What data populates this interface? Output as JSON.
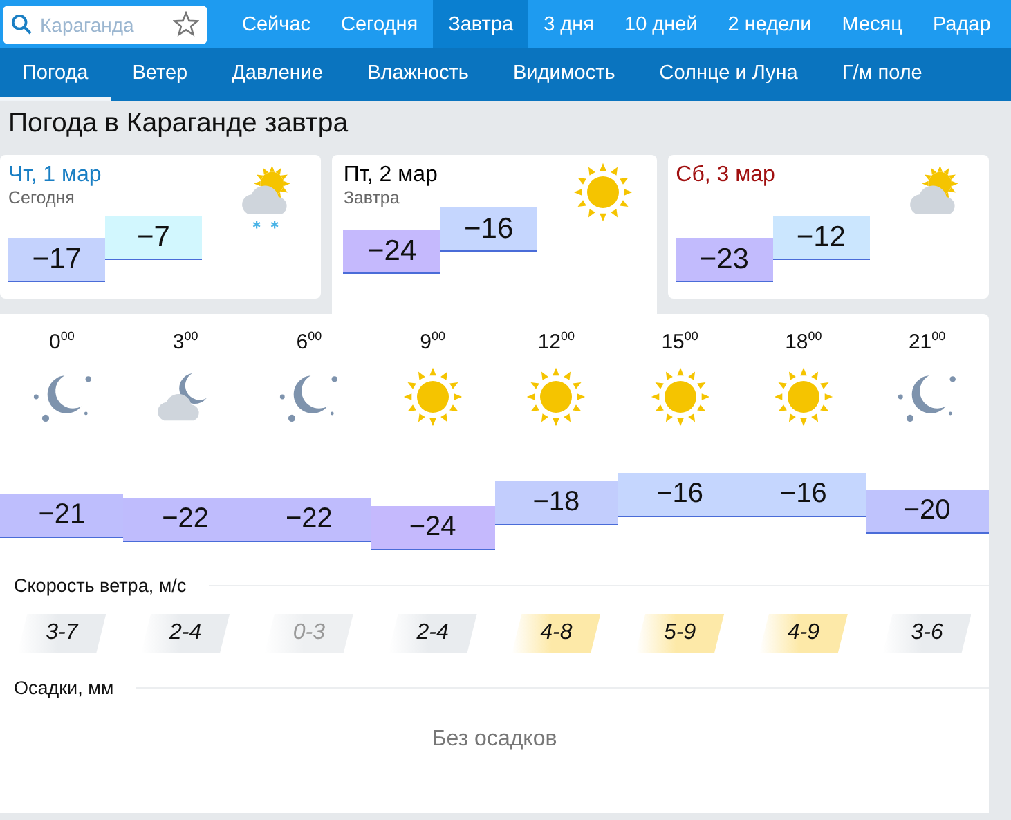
{
  "search": {
    "placeholder": "Караганда"
  },
  "nav_tabs": [
    {
      "label": "Сейчас",
      "selected": false
    },
    {
      "label": "Сегодня",
      "selected": false
    },
    {
      "label": "Завтра",
      "selected": true
    },
    {
      "label": "3 дня",
      "selected": false
    },
    {
      "label": "10 дней",
      "selected": false
    },
    {
      "label": "2 недели",
      "selected": false
    },
    {
      "label": "Месяц",
      "selected": false
    },
    {
      "label": "Радар",
      "selected": false
    }
  ],
  "sub_tabs": [
    {
      "label": "Погода",
      "selected": true
    },
    {
      "label": "Ветер",
      "selected": false
    },
    {
      "label": "Давление",
      "selected": false
    },
    {
      "label": "Влажность",
      "selected": false
    },
    {
      "label": "Видимость",
      "selected": false
    },
    {
      "label": "Солнце и Луна",
      "selected": false
    },
    {
      "label": "Г/м поле",
      "selected": false
    }
  ],
  "title": "Погода в Караганде завтра",
  "days": [
    {
      "name": "Чт, 1 мар",
      "color": "#1a7fc4",
      "note": "Сегодня",
      "kind": "snow",
      "min": "−17",
      "max": "−7",
      "selected": false
    },
    {
      "name": "Пт, 2 мар",
      "color": "#000000",
      "note": "Завтра",
      "kind": "sunny",
      "min": "−24",
      "max": "−16",
      "selected": true
    },
    {
      "name": "Сб, 3 мар",
      "color": "#a01010",
      "kind": "cloudy",
      "min": "−23",
      "max": "−12",
      "selected": false
    }
  ],
  "hours": [
    {
      "time": "0$^{00}$",
      "kind": "night",
      "temp": "−21"
    },
    {
      "time": "3$^{00}$",
      "kind": "cloudy",
      "temp": "−22"
    },
    {
      "time": "6$^{00}$",
      "kind": "night",
      "temp": "−22"
    },
    {
      "time": "9$^{00}$",
      "kind": "sunny",
      "temp": "−24"
    },
    {
      "time": "12$^{00}$",
      "kind": "sunny",
      "temp": "−18"
    },
    {
      "time": "15$^{00}$",
      "kind": "sunny",
      "temp": "−16"
    },
    {
      "time": "18$^{00}$",
      "kind": "sunny",
      "temp": "−16"
    },
    {
      "time": "21$^{00}$",
      "kind": "night",
      "temp": "−20"
    }
  ],
  "wind_label": "Скорость ветра, м/с",
  "winds": [
    {
      "text": "3-7",
      "kind": "normal"
    },
    {
      "text": "2-4",
      "kind": "normal"
    },
    {
      "text": "0-3",
      "kind": "calm"
    },
    {
      "text": "2-4",
      "kind": "normal"
    },
    {
      "text": "4-8",
      "kind": "strong"
    },
    {
      "text": "5-9",
      "kind": "strong"
    },
    {
      "text": "4-9",
      "kind": "strong"
    },
    {
      "text": "3-6",
      "kind": "normal"
    }
  ],
  "precip_label": "Осадки, мм",
  "precip_text": "Без осадков"
}
